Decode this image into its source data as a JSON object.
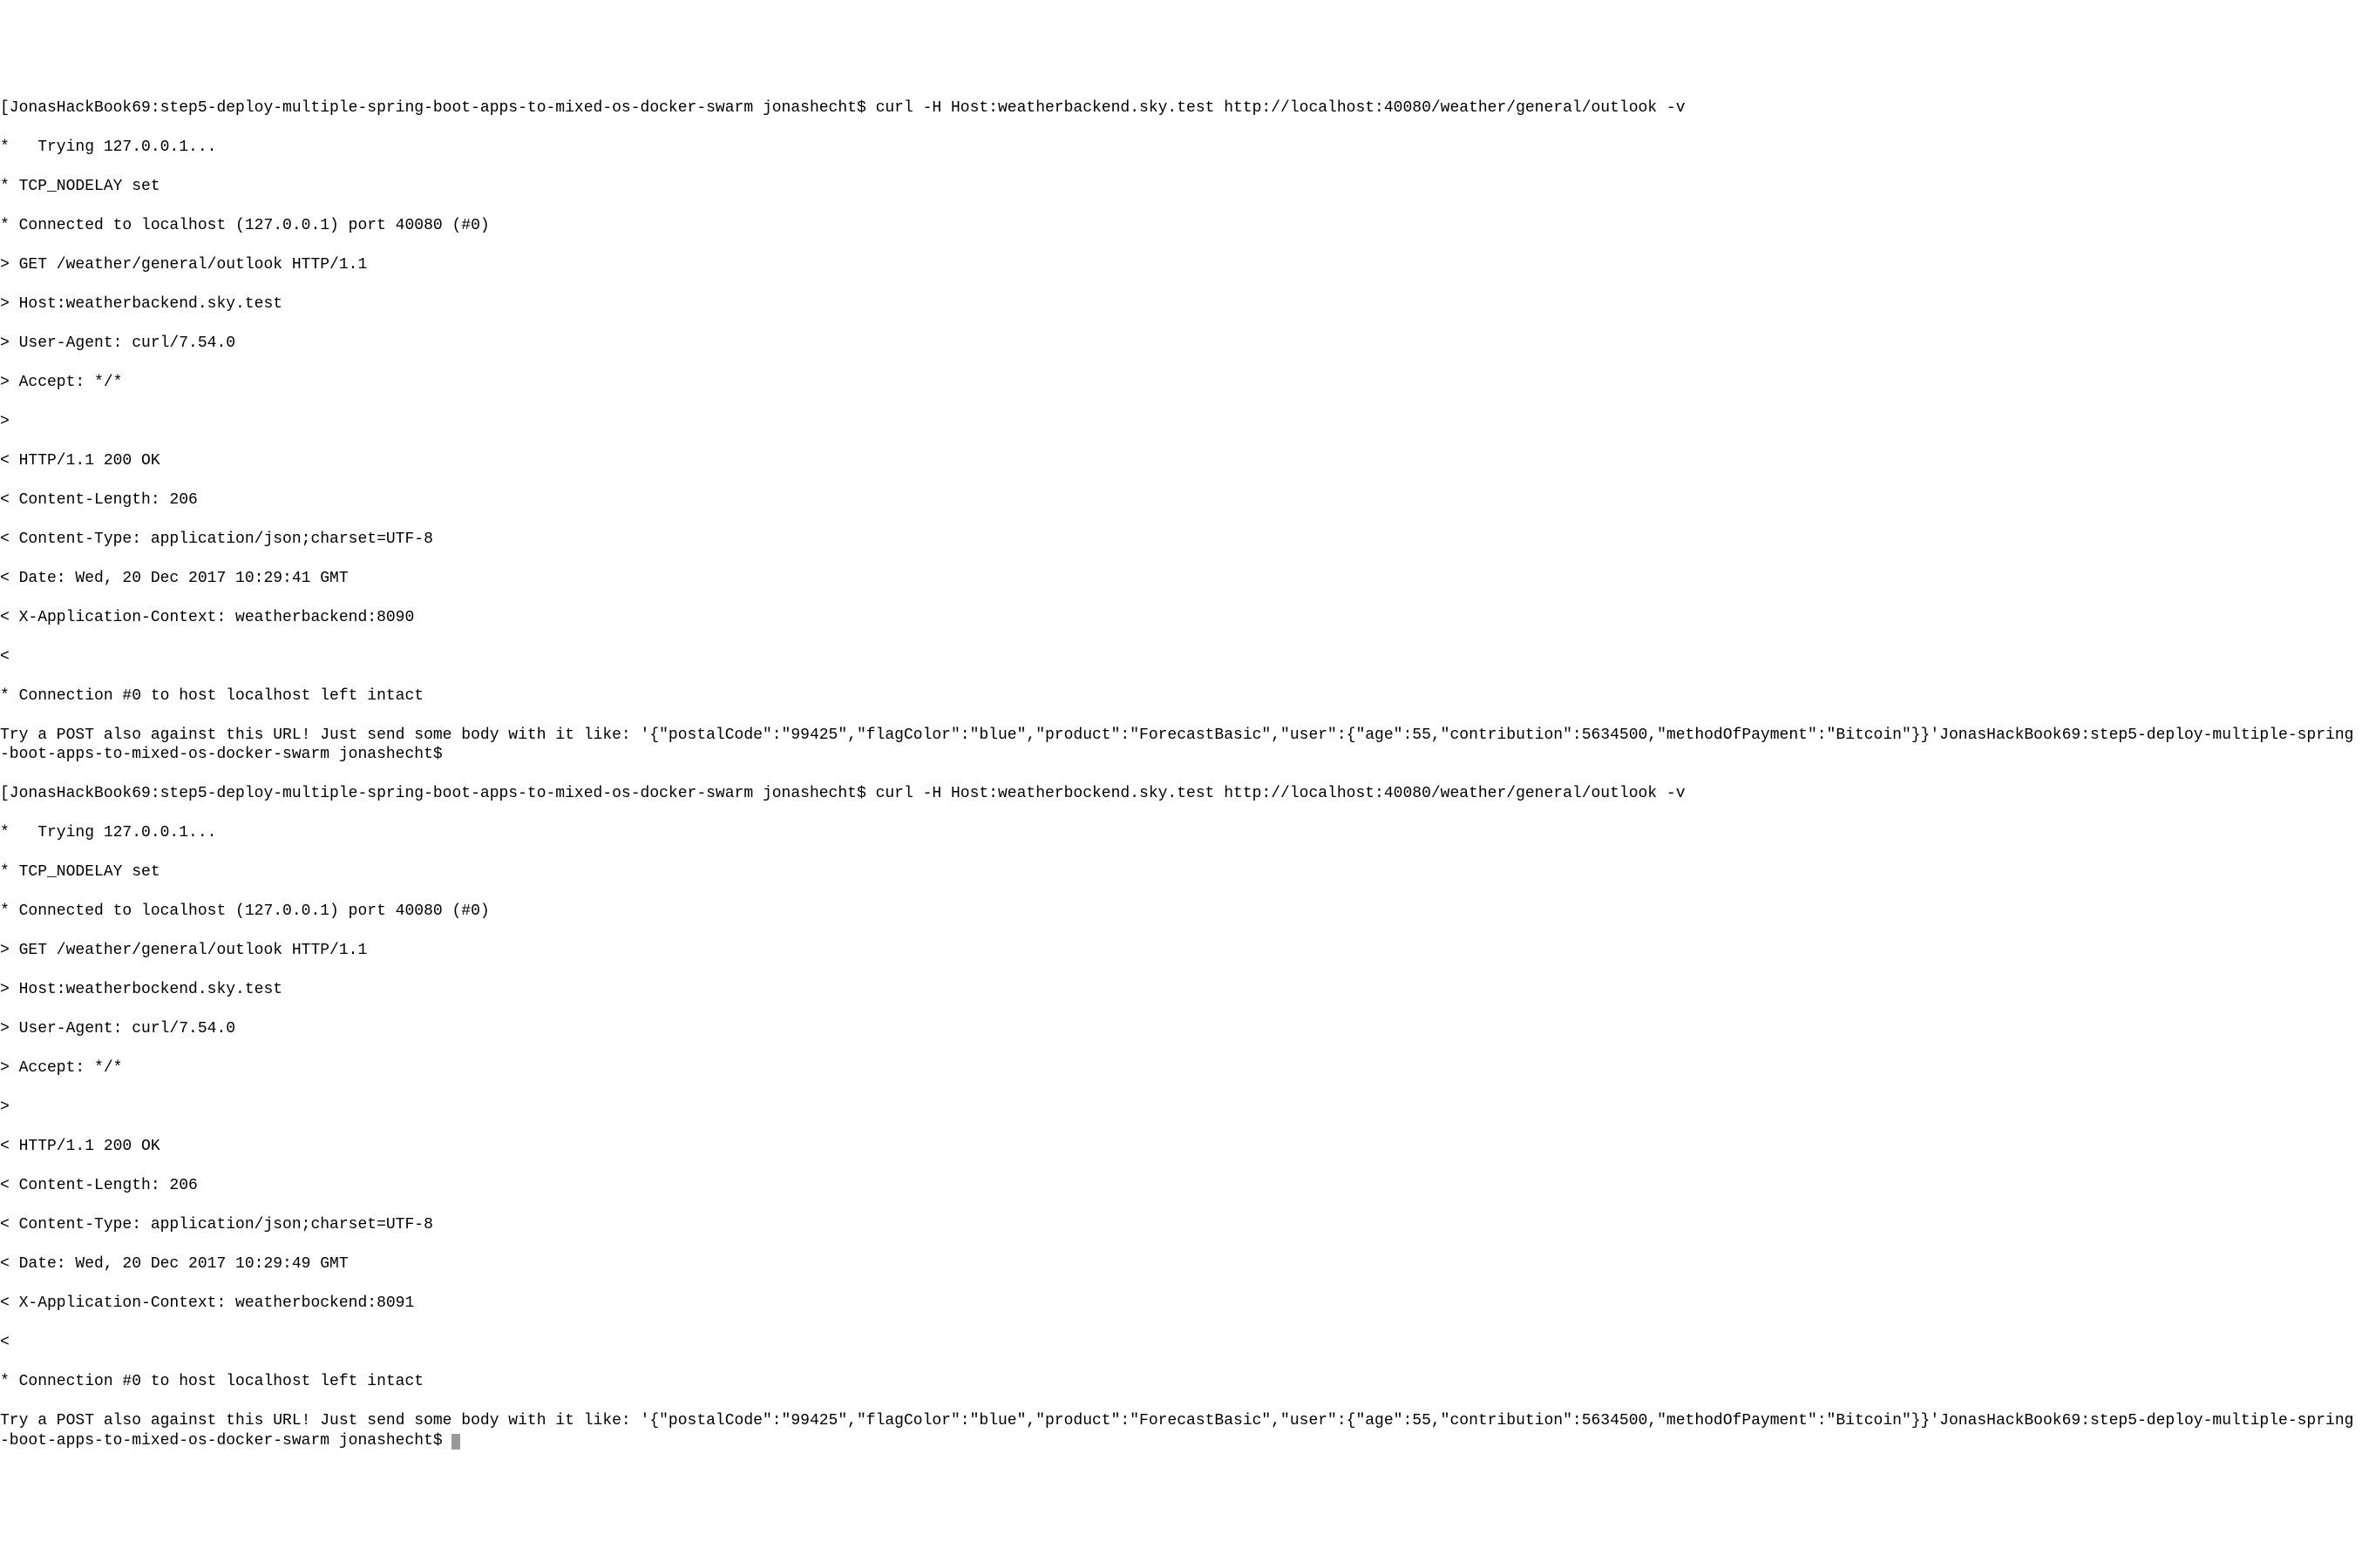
{
  "terminal": {
    "lines": [
      "[JonasHackBook69:step5-deploy-multiple-spring-boot-apps-to-mixed-os-docker-swarm jonashecht$ curl -H Host:weatherbackend.sky.test http://localhost:40080/weather/general/outlook -v",
      "*   Trying 127.0.0.1...",
      "* TCP_NODELAY set",
      "* Connected to localhost (127.0.0.1) port 40080 (#0)",
      "> GET /weather/general/outlook HTTP/1.1",
      "> Host:weatherbackend.sky.test",
      "> User-Agent: curl/7.54.0",
      "> Accept: */*",
      ">",
      "< HTTP/1.1 200 OK",
      "< Content-Length: 206",
      "< Content-Type: application/json;charset=UTF-8",
      "< Date: Wed, 20 Dec 2017 10:29:41 GMT",
      "< X-Application-Context: weatherbackend:8090",
      "<",
      "* Connection #0 to host localhost left intact",
      "Try a POST also against this URL! Just send some body with it like: '{\"postalCode\":\"99425\",\"flagColor\":\"blue\",\"product\":\"ForecastBasic\",\"user\":{\"age\":55,\"contribution\":5634500,\"methodOfPayment\":\"Bitcoin\"}}'JonasHackBook69:step5-deploy-multiple-spring-boot-apps-to-mixed-os-docker-swarm jonashecht$",
      "[JonasHackBook69:step5-deploy-multiple-spring-boot-apps-to-mixed-os-docker-swarm jonashecht$ curl -H Host:weatherbockend.sky.test http://localhost:40080/weather/general/outlook -v",
      "*   Trying 127.0.0.1...",
      "* TCP_NODELAY set",
      "* Connected to localhost (127.0.0.1) port 40080 (#0)",
      "> GET /weather/general/outlook HTTP/1.1",
      "> Host:weatherbockend.sky.test",
      "> User-Agent: curl/7.54.0",
      "> Accept: */*",
      ">",
      "< HTTP/1.1 200 OK",
      "< Content-Length: 206",
      "< Content-Type: application/json;charset=UTF-8",
      "< Date: Wed, 20 Dec 2017 10:29:49 GMT",
      "< X-Application-Context: weatherbockend:8091",
      "<",
      "* Connection #0 to host localhost left intact",
      "Try a POST also against this URL! Just send some body with it like: '{\"postalCode\":\"99425\",\"flagColor\":\"blue\",\"product\":\"ForecastBasic\",\"user\":{\"age\":55,\"contribution\":5634500,\"methodOfPayment\":\"Bitcoin\"}}'JonasHackBook69:step5-deploy-multiple-spring-boot-apps-to-mixed-os-docker-swarm jonashecht$ "
    ]
  }
}
